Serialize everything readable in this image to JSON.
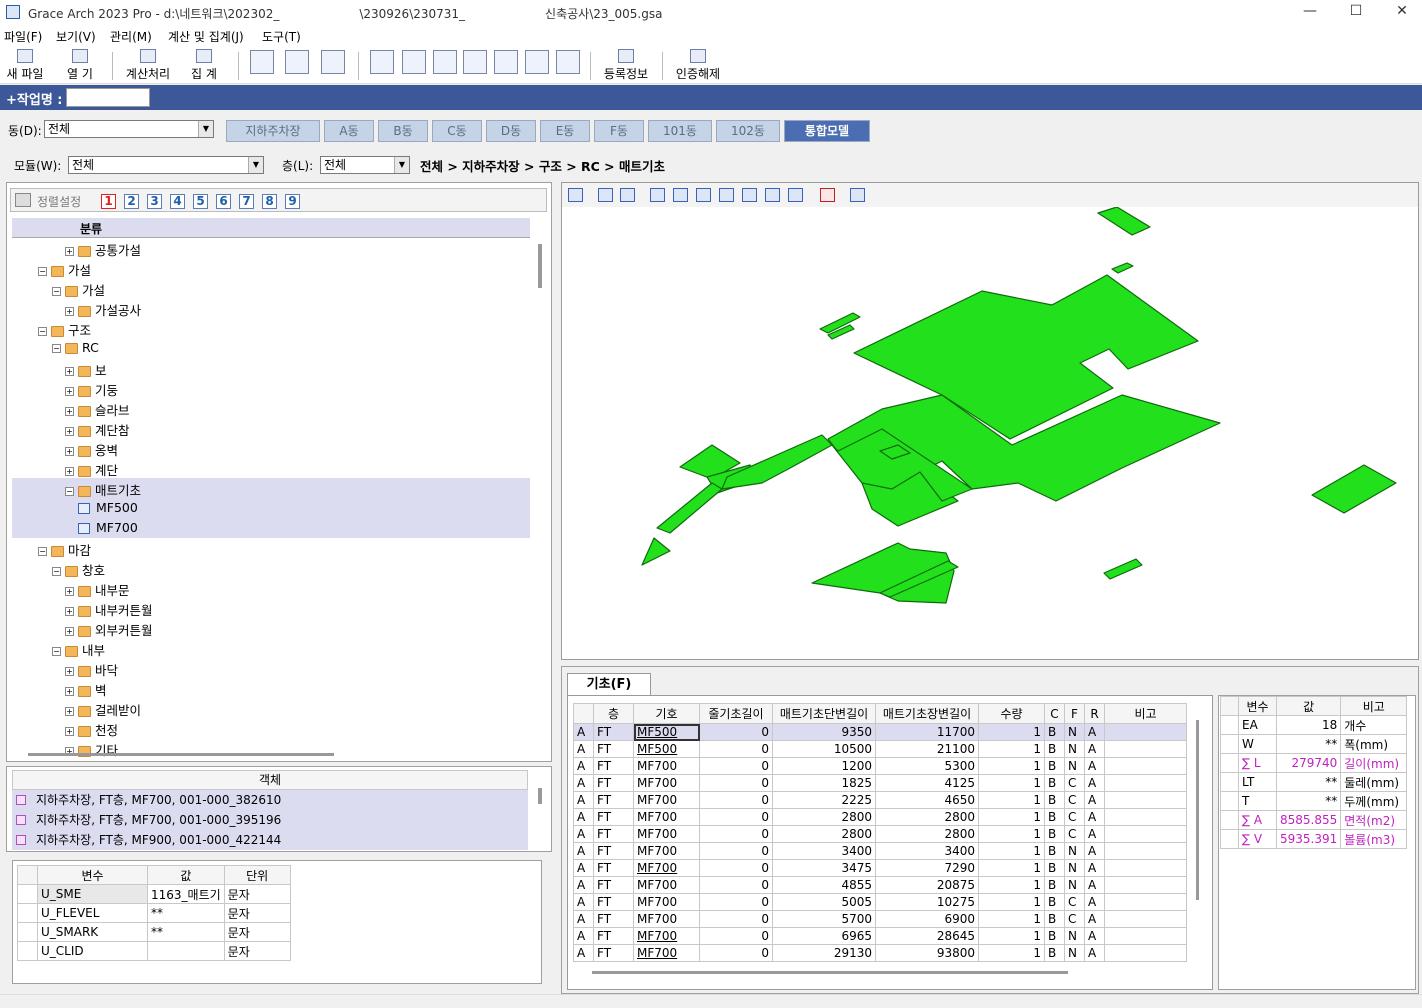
{
  "window": {
    "title_parts": [
      "Grace Arch 2023 Pro - d:\\네트워크\\202302_",
      "\\230926\\230731_",
      "신축공사\\23_005.gsa"
    ],
    "minimize": "—",
    "maximize": "☐",
    "close": "✕"
  },
  "menu": [
    "파일(F)",
    "보기(V)",
    "관리(M)",
    "계산 및 집계(J)",
    "도구(T)"
  ],
  "toolbar": {
    "new_file": "새 파일",
    "open": "열 기",
    "calc": "계산처리",
    "aggregate": "집 계",
    "register": "등록정보",
    "unauth": "인증해제",
    "icons": [
      "new-file-icon",
      "open-icon",
      "calc-icon",
      "aggregate-icon",
      "find-icon",
      "zoom-icon",
      "preview-icon",
      "window1-icon",
      "window2-icon",
      "window3-icon",
      "window4-icon",
      "window5-icon",
      "window6-icon",
      "window7-icon",
      "register-icon",
      "unauth-icon"
    ]
  },
  "work": {
    "label": "+작업명 :",
    "value": ""
  },
  "dong": {
    "label": "동(D):",
    "value": "전체"
  },
  "tabs": [
    "지하주차장",
    "A동",
    "B동",
    "C동",
    "D동",
    "E동",
    "F동",
    "101동",
    "102동",
    "통합모델"
  ],
  "active_tab": "통합모델",
  "module": {
    "label": "모듈(W):",
    "value": "전체"
  },
  "floor": {
    "label": "층(L):",
    "value": "전체"
  },
  "breadcrumb": "전체 > 지하주차장 > 구조 > RC > 매트기초",
  "sort": {
    "label": "정렬설정",
    "numbers": [
      "1",
      "2",
      "3",
      "4",
      "5",
      "6",
      "7",
      "8",
      "9"
    ]
  },
  "tree": {
    "header": "분류",
    "items": [
      {
        "label": "공통가설",
        "level": 3,
        "type": "folder",
        "expander": "+"
      },
      {
        "label": "가설",
        "level": 1,
        "type": "folder",
        "expander": "−"
      },
      {
        "label": "가설",
        "level": 2,
        "type": "folder",
        "expander": "−"
      },
      {
        "label": "가설공사",
        "level": 3,
        "type": "folder",
        "expander": "+"
      },
      {
        "label": "구조",
        "level": 1,
        "type": "folder",
        "expander": "−"
      },
      {
        "label": "RC",
        "level": 2,
        "type": "folder",
        "expander": "−"
      },
      {
        "label": "보",
        "level": 3,
        "type": "folder",
        "expander": "+"
      },
      {
        "label": "기둥",
        "level": 3,
        "type": "folder",
        "expander": "+"
      },
      {
        "label": "슬라브",
        "level": 3,
        "type": "folder",
        "expander": "+"
      },
      {
        "label": "계단참",
        "level": 3,
        "type": "folder",
        "expander": "+"
      },
      {
        "label": "옹벽",
        "level": 3,
        "type": "folder",
        "expander": "+"
      },
      {
        "label": "계단",
        "level": 3,
        "type": "folder",
        "expander": "+"
      },
      {
        "label": "매트기초",
        "level": 3,
        "type": "folder",
        "expander": "−",
        "selected": true
      },
      {
        "label": "MF500",
        "level": 4,
        "type": "leaf",
        "selected": true
      },
      {
        "label": "MF700",
        "level": 4,
        "type": "leaf",
        "selected": true
      },
      {
        "label": "마감",
        "level": 1,
        "type": "folder",
        "expander": "−"
      },
      {
        "label": "창호",
        "level": 2,
        "type": "folder",
        "expander": "−"
      },
      {
        "label": "내부문",
        "level": 3,
        "type": "folder",
        "expander": "+"
      },
      {
        "label": "내부커튼월",
        "level": 3,
        "type": "folder",
        "expander": "+"
      },
      {
        "label": "외부커튼월",
        "level": 3,
        "type": "folder",
        "expander": "+"
      },
      {
        "label": "내부",
        "level": 2,
        "type": "folder",
        "expander": "−"
      },
      {
        "label": "바닥",
        "level": 3,
        "type": "folder",
        "expander": "+"
      },
      {
        "label": "벽",
        "level": 3,
        "type": "folder",
        "expander": "+"
      },
      {
        "label": "걸레받이",
        "level": 3,
        "type": "folder",
        "expander": "+"
      },
      {
        "label": "천정",
        "level": 3,
        "type": "folder",
        "expander": "+"
      },
      {
        "label": "기타",
        "level": 3,
        "type": "folder",
        "expander": "+"
      }
    ]
  },
  "objects": {
    "header": "객체",
    "rows": [
      "지하주차장, FT층, MF700, 001-000_382610",
      "지하주차장, FT층, MF700, 001-000_395196",
      "지하주차장, FT층, MF900, 001-000_422144"
    ]
  },
  "vars": {
    "headers": [
      "변수",
      "값",
      "단위"
    ],
    "rows": [
      [
        "U_SME",
        "1163_매트기",
        "문자"
      ],
      [
        "U_FLEVEL",
        "**",
        "문자"
      ],
      [
        "U_SMARK",
        "**",
        "문자"
      ],
      [
        "U_CLID",
        "",
        "문자"
      ]
    ]
  },
  "viewer": {
    "shape_color": "#22e01c",
    "edge_color": "#0f6b0d"
  },
  "bottom_tab": "기초(F)",
  "grid": {
    "headers": [
      "층",
      "기호",
      "줄기초길이",
      "매트기초단변길이",
      "매트기초장변길이",
      "수량",
      "C",
      "F",
      "R",
      "비고"
    ],
    "rows": [
      [
        "A",
        "FT",
        "MF500",
        "0",
        "9350",
        "11700",
        "1",
        "B",
        "N",
        "A",
        ""
      ],
      [
        "A",
        "FT",
        "MF500",
        "0",
        "10500",
        "21100",
        "1",
        "B",
        "N",
        "A",
        ""
      ],
      [
        "A",
        "FT",
        "MF700",
        "0",
        "1200",
        "5300",
        "1",
        "B",
        "N",
        "A",
        ""
      ],
      [
        "A",
        "FT",
        "MF700",
        "0",
        "1825",
        "4125",
        "1",
        "B",
        "C",
        "A",
        ""
      ],
      [
        "A",
        "FT",
        "MF700",
        "0",
        "2225",
        "4650",
        "1",
        "B",
        "C",
        "A",
        ""
      ],
      [
        "A",
        "FT",
        "MF700",
        "0",
        "2800",
        "2800",
        "1",
        "B",
        "C",
        "A",
        ""
      ],
      [
        "A",
        "FT",
        "MF700",
        "0",
        "2800",
        "2800",
        "1",
        "B",
        "C",
        "A",
        ""
      ],
      [
        "A",
        "FT",
        "MF700",
        "0",
        "3400",
        "3400",
        "1",
        "B",
        "N",
        "A",
        ""
      ],
      [
        "A",
        "FT",
        "MF700",
        "0",
        "3475",
        "7290",
        "1",
        "B",
        "N",
        "A",
        ""
      ],
      [
        "A",
        "FT",
        "MF700",
        "0",
        "4855",
        "20875",
        "1",
        "B",
        "N",
        "A",
        ""
      ],
      [
        "A",
        "FT",
        "MF700",
        "0",
        "5005",
        "10275",
        "1",
        "B",
        "C",
        "A",
        ""
      ],
      [
        "A",
        "FT",
        "MF700",
        "0",
        "5700",
        "6900",
        "1",
        "B",
        "C",
        "A",
        ""
      ],
      [
        "A",
        "FT",
        "MF700",
        "0",
        "6965",
        "28645",
        "1",
        "B",
        "N",
        "A",
        ""
      ],
      [
        "A",
        "FT",
        "MF700",
        "0",
        "29130",
        "93800",
        "1",
        "B",
        "N",
        "A",
        ""
      ]
    ],
    "underlined_rows": [
      0,
      1,
      8,
      12,
      13
    ]
  },
  "summary": {
    "headers": [
      "변수",
      "값",
      "비고"
    ],
    "rows": [
      [
        "EA",
        "18",
        "개수",
        false
      ],
      [
        "W",
        "**",
        "폭(mm)",
        false
      ],
      [
        "∑ L",
        "279740",
        "길이(mm)",
        true
      ],
      [
        "LT",
        "**",
        "둘레(mm)",
        false
      ],
      [
        "T",
        "**",
        "두께(mm)",
        false
      ],
      [
        "∑ A",
        "8585.855",
        "면적(m2)",
        true
      ],
      [
        "∑ V",
        "5935.391",
        "볼륨(m3)",
        true
      ]
    ]
  }
}
